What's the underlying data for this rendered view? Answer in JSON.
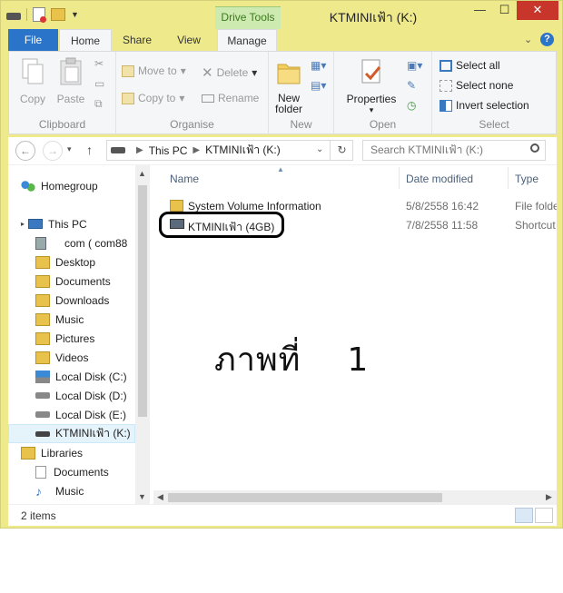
{
  "title_bar": {
    "context_tab": "Drive Tools",
    "window_title": "KTMINIเฟ้า (K:)",
    "minimize": "—",
    "maximize": "☐",
    "close": "✕"
  },
  "tabs": {
    "file": "File",
    "home": "Home",
    "share": "Share",
    "view": "View",
    "manage": "Manage",
    "collapse": "⌄",
    "help": "?"
  },
  "ribbon": {
    "clipboard": {
      "label": "Clipboard",
      "copy": "Copy",
      "paste": "Paste"
    },
    "organise": {
      "label": "Organise",
      "move_to": "Move to",
      "copy_to": "Copy to",
      "delete": "Delete",
      "rename": "Rename"
    },
    "new": {
      "label": "New",
      "new_folder_line1": "New",
      "new_folder_line2": "folder"
    },
    "open": {
      "label": "Open",
      "properties": "Properties"
    },
    "select": {
      "label": "Select",
      "select_all": "Select all",
      "select_none": "Select none",
      "invert": "Invert selection"
    }
  },
  "address": {
    "back": "←",
    "forward": "→",
    "up": "↑",
    "crumbs": [
      "This PC",
      "KTMINIเฟ้า (K:)"
    ],
    "refresh": "↻",
    "search_placeholder": "Search KTMINIเฟ้า (K:)"
  },
  "sidebar": {
    "homegroup": "Homegroup",
    "this_pc": "This PC",
    "items": [
      "com (    com88",
      "Desktop",
      "Documents",
      "Downloads",
      "Music",
      "Pictures",
      "Videos",
      "Local Disk (C:)",
      "Local Disk (D:)",
      "Local Disk (E:)",
      "KTMINIเฟ้า (K:)"
    ],
    "libraries": "Libraries",
    "lib_items": [
      "Documents",
      "Music"
    ]
  },
  "columns": {
    "name": "Name",
    "date": "Date modified",
    "type": "Type"
  },
  "files": [
    {
      "name": "System Volume Information",
      "date": "5/8/2558 16:42",
      "type": "File folder"
    },
    {
      "name": "KTMINIเฟ้า (4GB)",
      "date": "7/8/2558 11:58",
      "type": "Shortcut"
    }
  ],
  "caption": {
    "thai": "ภาพที่",
    "number": "1"
  },
  "status": {
    "count": "2 items"
  },
  "colors": {
    "frame": "#eeea8c",
    "file_tab": "#2a74c9",
    "context_tab": "#cdeab0",
    "close": "#c7352b"
  }
}
